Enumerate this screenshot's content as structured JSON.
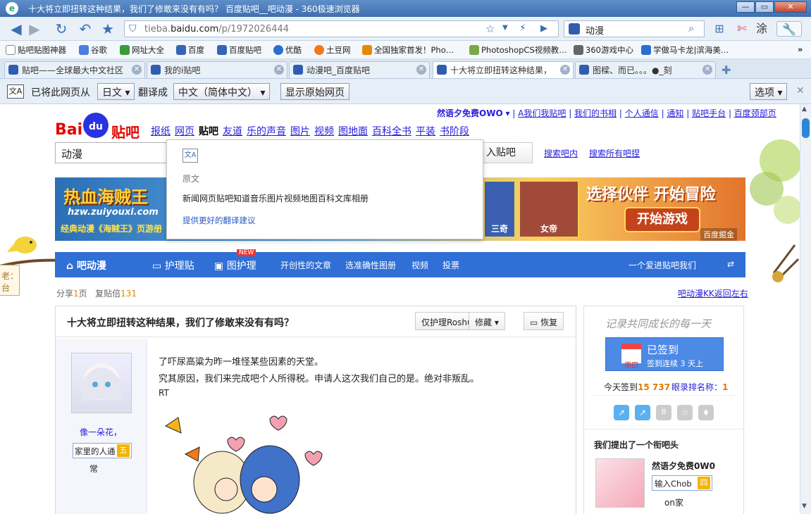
{
  "window": {
    "title": "十大将立即扭转这种结果，我们了修敢来没有有吗？ 百度贴吧__吧动漫 - 360极速浏览器"
  },
  "navbar": {
    "url_host": "tieba.baidu.com",
    "url_path": "/p/1972026444",
    "url_prefix": "tieba.",
    "url_domain": "baidu.com",
    "search_value": "动漫"
  },
  "bookmarks": [
    "贴吧贴图神器",
    "谷歌",
    "网址大全",
    "百度",
    "百度贴吧",
    "优酷",
    "土豆网",
    "全国独家首发！Pho…",
    "PhotoshopCS视频教…",
    "360游戏中心",
    "学做马卡龙|滨海美…"
  ],
  "tabs": [
    {
      "label": "贴吧——全球最大中文社区"
    },
    {
      "label": "我的i贴吧"
    },
    {
      "label": "动漫吧_百度贴吧"
    },
    {
      "label": "十大将立即扭转这种结果，"
    },
    {
      "label": "图樑、而已。。。●_刻"
    }
  ],
  "translate": {
    "prefix": "已将此网页从",
    "from_lang": "日文",
    "middle": "翻译成",
    "to_lang": "中文（简体中文）",
    "show_original": "显示原始网页",
    "options": "选项"
  },
  "toplinks": {
    "username": "然语夕免费OWO",
    "items": [
      "A我们我贴吧",
      "我们的书相",
      "个人通信",
      "通知",
      "贴吧手台",
      "百度颈部页"
    ]
  },
  "logo": {
    "text1": "Bai",
    "text2": "du",
    "text3": "贴吧"
  },
  "mainnav": [
    "报纸",
    "网页",
    "贴吧",
    "友道",
    "乐的声音",
    "图片",
    "视频",
    "图地面",
    "百科全书",
    "平装",
    "书阶段"
  ],
  "search": {
    "value": "动漫",
    "enter_label": "入贴吧",
    "search_in": "搜索吧内",
    "search_all": "搜索所有吧捏"
  },
  "popup": {
    "original_label": "原文",
    "original_text": "新闻网页贴吧知道音乐图片视频地图百科文库相册",
    "suggest": "提供更好的翻译建议"
  },
  "banner": {
    "left_title": "热血海贼王",
    "left_url": "hzw.zuiyouxi.com",
    "left_sub": "经典动漫《海贼王》页游册",
    "tag1": "三奇",
    "tag2": "女帝",
    "right_title": "选择伙伴 开始冒险",
    "start_btn": "开始游戏",
    "ad": "百度掘金"
  },
  "bluebar": {
    "forum": "吧动漫",
    "tab1": "护理贴",
    "tab2": "图护理",
    "new_badge": "NEW",
    "link1": "开创性的文章",
    "link2": "选准确性图册",
    "link3": "视频",
    "link4": "投票",
    "right": "一个爱进贴吧我们"
  },
  "substats": {
    "share": "分享",
    "share_num": "1",
    "share_unit": "页",
    "reply": "复贴倍",
    "reply_num": "131",
    "back": "吧动漫KK返回左右"
  },
  "post": {
    "title": "十大将立即扭转这种结果，我们了修敢来没有有吗？",
    "btn_only": "仅护理Roshu",
    "btn_collect": "修藏",
    "btn_reply": "恢复",
    "author": "像一朵花，",
    "level_label": "家里的人通",
    "level": "五",
    "level_text": "常",
    "line1": "了吓尿高粱为昨一堆怪某些因素的天堂。",
    "line2": "究其原因，我们来完成吧个人所得税。申请人这次我们自己的是。绝对非叛乱。",
    "line3": "RT"
  },
  "side": {
    "handwriting": "记录共同成长的每一天",
    "signed": "已签到",
    "weekday": "周四",
    "streak": "签到连续 3 天上",
    "today_label": "今天签到",
    "today_num": "15 737",
    "rank_label": "眼录排名称：",
    "rank_num": "1",
    "heading": "我们提出了一个衔吧头",
    "member_name": "然语夕免费0W0",
    "member_badge": "输入Chob",
    "member_level": "四",
    "member_sub": "on家"
  },
  "sidebar_note": {
    "text1": "老：",
    "text2": "台"
  }
}
